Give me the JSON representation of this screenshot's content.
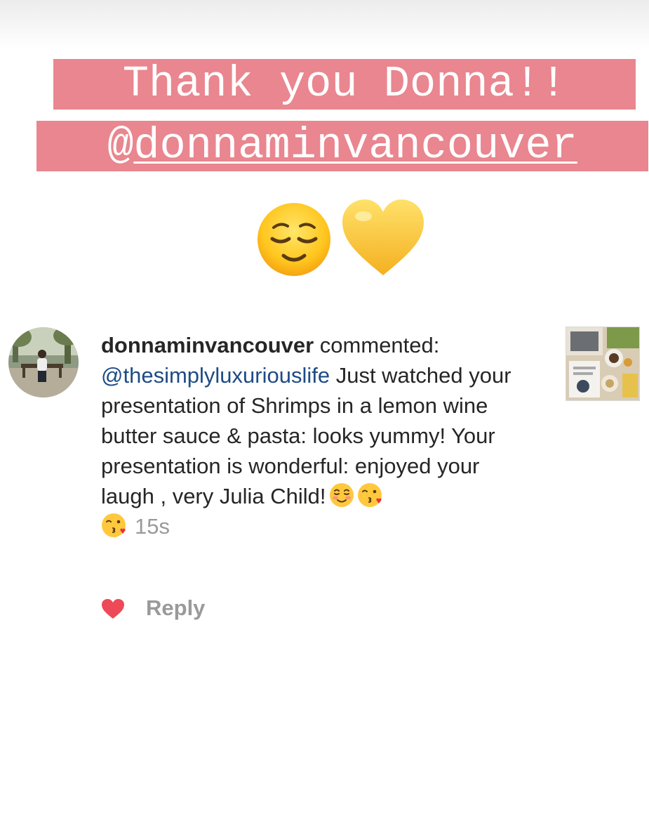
{
  "caption": {
    "line1": "Thank you Donna!!",
    "line2_prefix": "@",
    "line2_mention": "donnaminvancouver"
  },
  "emojis": {
    "first": "relieved-face-icon",
    "second": "yellow-heart-icon"
  },
  "comment": {
    "username": "donnaminvancouver",
    "verb": " commented:",
    "mention": "@thesimplyluxuriouslife",
    "body": "  Just watched your presentation of Shrimps in a lemon wine butter sauce & pasta: looks yummy! Your presentation is wonderful: enjoyed your laugh , very Julia Child!",
    "trailing_emojis": [
      "smiling-face-icon",
      "kissing-face-icon",
      "kissing-face-icon"
    ],
    "timestamp": "15s"
  },
  "actions": {
    "like_icon": "heart-icon",
    "reply_label": "Reply"
  },
  "colors": {
    "caption_bg": "#e9868f",
    "caption_text": "#ffffff",
    "mention": "#1e4b85",
    "heart": "#ed4956",
    "muted": "#9a9a9a"
  }
}
